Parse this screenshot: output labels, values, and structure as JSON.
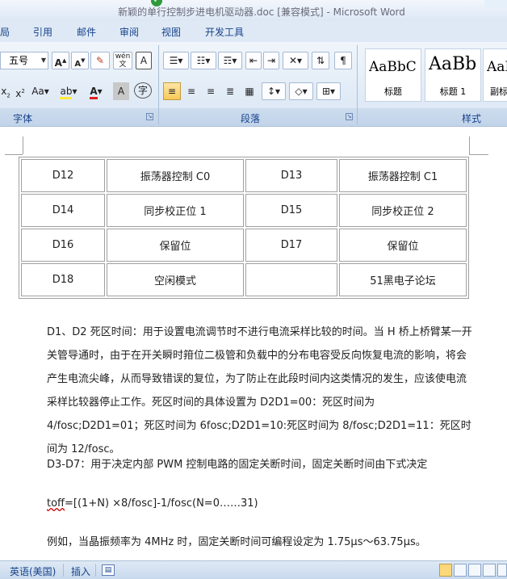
{
  "window": {
    "title": "新颖的单行控制步进电机驱动器.doc [兼容模式] - Microsoft Word"
  },
  "menu": {
    "tabs": [
      "局",
      "引用",
      "邮件",
      "审阅",
      "视图",
      "开发工具"
    ]
  },
  "ribbon": {
    "font_group_label": "字体",
    "paragraph_group_label": "段落",
    "styles_group_label": "样式",
    "font_size": "五号",
    "styles": [
      {
        "preview": "AaBbC",
        "name": "标题"
      },
      {
        "preview": "AaBb",
        "name": "标题 1"
      },
      {
        "preview": "AaI",
        "name": "副标"
      }
    ]
  },
  "table": {
    "rows": [
      [
        "D12",
        "振荡器控制 C0",
        "D13",
        "振荡器控制 C1"
      ],
      [
        "D14",
        "同步校正位 1",
        "D15",
        "同步校正位 2"
      ],
      [
        "D16",
        "保留位",
        "D17",
        "保留位"
      ],
      [
        "D18",
        "空闲模式",
        "",
        "51黑电子论坛"
      ]
    ]
  },
  "body": {
    "para1": "D1、D2 死区时间：用于设置电流调节时不进行电流采样比较的时间。当 H 桥上桥臂某一开关管导通时，由于在开关瞬时箝位二极管和负载中的分布电容受反向恢复电流的影响，将会产生电流尖峰，从而导致错误的复位，为了防止在此段时间内这类情况的发生，应该使电流采样比较器停止工作。死区时间的具体设置为 D2D1=00：死区时间为 4/fosc;D2D1=01；死区时间为 6fosc;D2D1=10:死区时间为 8/fosc;D2D1=11：死区时间为 12/fosc。",
    "para2": "D3-D7：用于决定内部 PWM 控制电路的固定关断时间，固定关断时间由下式决定",
    "formula_prefix": "toff",
    "formula_rest": "=[(1+N) ×8/fosc]-1/fosc(N=0……31)",
    "para3": "例如，当晶振频率为 4MHz 时，固定关断时间可编程设定为 1.75μs～63.75μs。"
  },
  "statusbar": {
    "language": "英语(美国)",
    "insert_mode": "插入"
  }
}
